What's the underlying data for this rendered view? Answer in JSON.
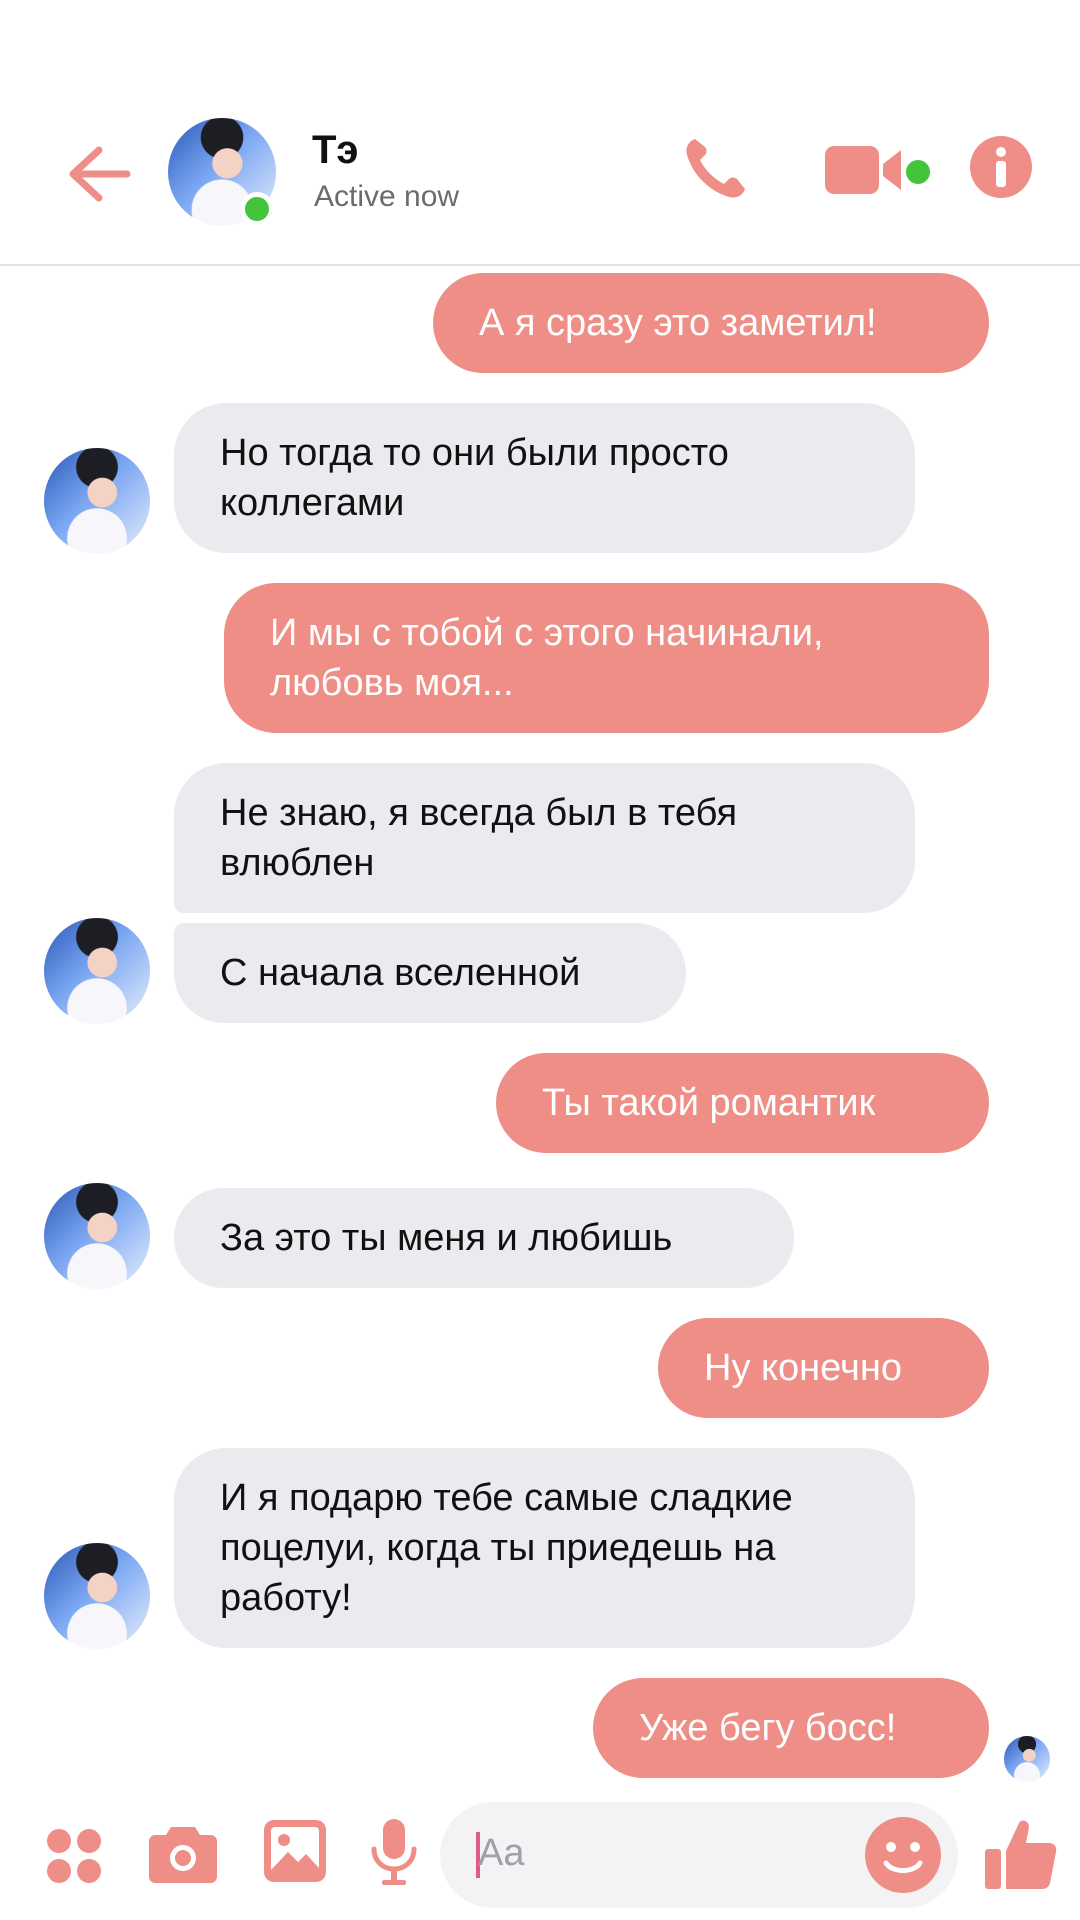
{
  "header": {
    "contact_name": "Тэ",
    "contact_status": "Active now"
  },
  "icons": {
    "back": "arrow-left-icon",
    "call": "phone-icon",
    "video": "video-camera-icon",
    "info": "info-icon",
    "apps": "apps-grid-icon",
    "camera": "camera-icon",
    "gallery": "image-icon",
    "voice": "microphone-icon",
    "emoji": "smile-icon",
    "like": "thumbs-up-icon"
  },
  "messages": [
    {
      "dir": "out",
      "text": "А я сразу это заметил!"
    },
    {
      "dir": "in",
      "text": "Но тогда то они были просто коллегами"
    },
    {
      "dir": "out",
      "text": "И мы с тобой с этого начинали, любовь моя..."
    },
    {
      "dir": "in",
      "text": "Не знаю, я всегда был в тебя влюблен"
    },
    {
      "dir": "in",
      "text": "С начала вселенной"
    },
    {
      "dir": "out",
      "text": "Ты такой романтик"
    },
    {
      "dir": "in",
      "text": "За это ты меня и любишь"
    },
    {
      "dir": "out",
      "text": "Ну конечно"
    },
    {
      "dir": "in",
      "text": "И я подарю тебе самые сладкие поцелуи, когда ты приедешь на работу!"
    },
    {
      "dir": "out",
      "text": "Уже бегу босс!"
    }
  ],
  "composer": {
    "placeholder": "Aa"
  },
  "colors": {
    "accent": "#ee8e86",
    "incoming_bubble": "#ebebef",
    "online": "#44c43a"
  }
}
